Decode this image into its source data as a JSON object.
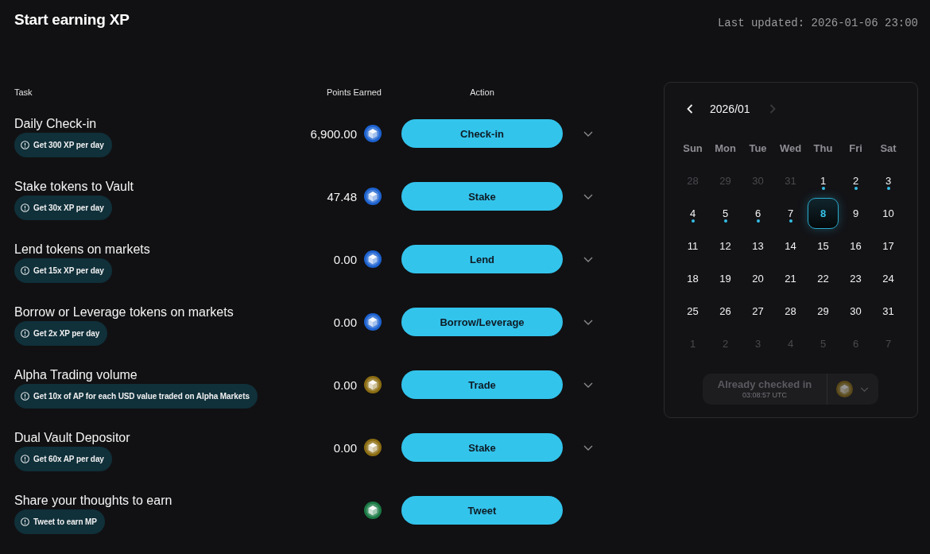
{
  "header": {
    "title": "Start earning XP",
    "last_updated": "Last updated: 2026-01-06 23:00"
  },
  "table": {
    "columns": [
      "Task",
      "Points Earned",
      "Action"
    ],
    "rows": [
      {
        "task": "Daily Check-in",
        "hint": "Get 300 XP per day",
        "points": "6,900.00",
        "color": "#1d63d1",
        "action": "Check-in",
        "expandable": true
      },
      {
        "task": "Stake tokens to Vault",
        "hint": "Get 30x XP per day",
        "points": "47.48",
        "color": "#1d63d1",
        "action": "Stake",
        "expandable": true
      },
      {
        "task": "Lend tokens on markets",
        "hint": "Get 15x XP per day",
        "points": "0.00",
        "color": "#1d63d1",
        "action": "Lend",
        "expandable": true
      },
      {
        "task": "Borrow or Leverage tokens on markets",
        "hint": "Get 2x XP per day",
        "points": "0.00",
        "color": "#1d63d1",
        "action": "Borrow/Leverage",
        "expandable": true
      },
      {
        "task": "Alpha Trading volume",
        "hint": "Get 10x of AP for each USD value traded on Alpha Markets",
        "points": "0.00",
        "color": "#8c6d12",
        "action": "Trade",
        "expandable": true
      },
      {
        "task": "Dual Vault Depositor",
        "hint": "Get 60x AP per day",
        "points": "0.00",
        "color": "#8c6d12",
        "action": "Stake",
        "expandable": true
      },
      {
        "task": "Share your thoughts to earn",
        "hint": "Tweet to earn MP",
        "color": "#1b7a45",
        "action": "Tweet",
        "expandable": false
      }
    ]
  },
  "calendar": {
    "month": "2026/01",
    "prev_disabled": false,
    "next_disabled": true,
    "weekdays": [
      "Sun",
      "Mon",
      "Tue",
      "Wed",
      "Thu",
      "Fri",
      "Sat"
    ],
    "weeks": [
      [
        {
          "day": "28",
          "in_month": false,
          "checked": false,
          "selected": false
        },
        {
          "day": "29",
          "in_month": false,
          "checked": false,
          "selected": false
        },
        {
          "day": "30",
          "in_month": false,
          "checked": false,
          "selected": false
        },
        {
          "day": "31",
          "in_month": false,
          "checked": false,
          "selected": false
        },
        {
          "day": "1",
          "in_month": true,
          "checked": true,
          "selected": false
        },
        {
          "day": "2",
          "in_month": true,
          "checked": true,
          "selected": false
        },
        {
          "day": "3",
          "in_month": true,
          "checked": true,
          "selected": false
        }
      ],
      [
        {
          "day": "4",
          "in_month": true,
          "checked": true,
          "selected": false
        },
        {
          "day": "5",
          "in_month": true,
          "checked": true,
          "selected": false
        },
        {
          "day": "6",
          "in_month": true,
          "checked": true,
          "selected": false
        },
        {
          "day": "7",
          "in_month": true,
          "checked": true,
          "selected": false
        },
        {
          "day": "8",
          "in_month": true,
          "checked": false,
          "selected": true
        },
        {
          "day": "9",
          "in_month": true,
          "checked": false,
          "selected": false
        },
        {
          "day": "10",
          "in_month": true,
          "checked": false,
          "selected": false
        }
      ],
      [
        {
          "day": "11",
          "in_month": true,
          "checked": false,
          "selected": false
        },
        {
          "day": "12",
          "in_month": true,
          "checked": false,
          "selected": false
        },
        {
          "day": "13",
          "in_month": true,
          "checked": false,
          "selected": false
        },
        {
          "day": "14",
          "in_month": true,
          "checked": false,
          "selected": false
        },
        {
          "day": "15",
          "in_month": true,
          "checked": false,
          "selected": false
        },
        {
          "day": "16",
          "in_month": true,
          "checked": false,
          "selected": false
        },
        {
          "day": "17",
          "in_month": true,
          "checked": false,
          "selected": false
        }
      ],
      [
        {
          "day": "18",
          "in_month": true,
          "checked": false,
          "selected": false
        },
        {
          "day": "19",
          "in_month": true,
          "checked": false,
          "selected": false
        },
        {
          "day": "20",
          "in_month": true,
          "checked": false,
          "selected": false
        },
        {
          "day": "21",
          "in_month": true,
          "checked": false,
          "selected": false
        },
        {
          "day": "22",
          "in_month": true,
          "checked": false,
          "selected": false
        },
        {
          "day": "23",
          "in_month": true,
          "checked": false,
          "selected": false
        },
        {
          "day": "24",
          "in_month": true,
          "checked": false,
          "selected": false
        }
      ],
      [
        {
          "day": "25",
          "in_month": true,
          "checked": false,
          "selected": false
        },
        {
          "day": "26",
          "in_month": true,
          "checked": false,
          "selected": false
        },
        {
          "day": "27",
          "in_month": true,
          "checked": false,
          "selected": false
        },
        {
          "day": "28",
          "in_month": true,
          "checked": false,
          "selected": false
        },
        {
          "day": "29",
          "in_month": true,
          "checked": false,
          "selected": false
        },
        {
          "day": "30",
          "in_month": true,
          "checked": false,
          "selected": false
        },
        {
          "day": "31",
          "in_month": true,
          "checked": false,
          "selected": false
        }
      ],
      [
        {
          "day": "1",
          "in_month": false,
          "checked": false,
          "selected": false
        },
        {
          "day": "2",
          "in_month": false,
          "checked": false,
          "selected": false
        },
        {
          "day": "3",
          "in_month": false,
          "checked": false,
          "selected": false
        },
        {
          "day": "4",
          "in_month": false,
          "checked": false,
          "selected": false
        },
        {
          "day": "5",
          "in_month": false,
          "checked": false,
          "selected": false
        },
        {
          "day": "6",
          "in_month": false,
          "checked": false,
          "selected": false
        },
        {
          "day": "7",
          "in_month": false,
          "checked": false,
          "selected": false
        }
      ]
    ],
    "checkin_button": {
      "label": "Already checked in",
      "time": "03:08:57 UTC",
      "disabled": true
    }
  }
}
